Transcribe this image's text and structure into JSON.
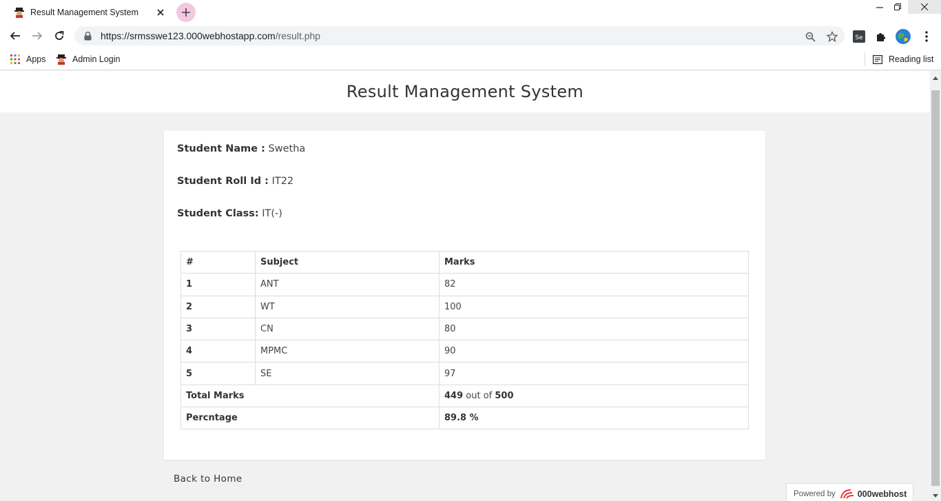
{
  "browser": {
    "tab_title": "Result Management System",
    "url_host": "https://srmsswe123.000webhostapp.com",
    "url_path": "/result.php",
    "bookmarks": [
      {
        "label": "Apps"
      },
      {
        "label": "Admin Login"
      }
    ],
    "reading_list_label": "Reading list"
  },
  "header": {
    "title": "Result Management System"
  },
  "student": {
    "name_label": "Student Name :",
    "name_value": "Swetha",
    "roll_label": "Student Roll Id :",
    "roll_value": "IT22",
    "class_label": "Student Class:",
    "class_value": "IT(-)"
  },
  "results": {
    "columns": [
      "#",
      "Subject",
      "Marks"
    ],
    "rows": [
      {
        "index": "1",
        "subject": "ANT",
        "marks": "82"
      },
      {
        "index": "2",
        "subject": "WT",
        "marks": "100"
      },
      {
        "index": "3",
        "subject": "CN",
        "marks": "80"
      },
      {
        "index": "4",
        "subject": "MPMC",
        "marks": "90"
      },
      {
        "index": "5",
        "subject": "SE",
        "marks": "97"
      }
    ],
    "total_label": "Total Marks",
    "total_obtained": "449",
    "total_mid": " out of ",
    "total_max": "500",
    "percentage_label": "Percntage",
    "percentage_value": "89.8 %"
  },
  "footer": {
    "back_link": "Back to Home",
    "powered_prefix": "Powered by",
    "powered_brand": "000webhost"
  }
}
